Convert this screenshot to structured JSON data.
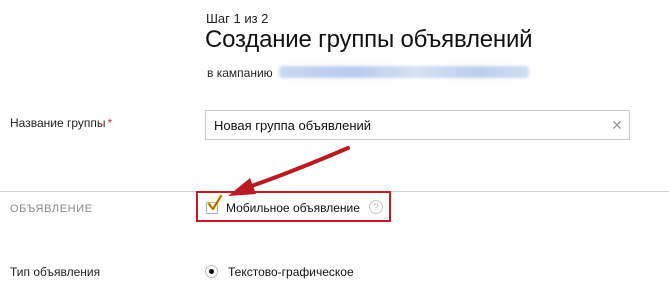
{
  "header": {
    "step": "Шаг 1 из 2",
    "title": "Создание группы объявлений",
    "campaign_label": "в кампанию"
  },
  "group_name": {
    "label": "Название группы",
    "required_mark": "*",
    "value": "Новая группа объявлений",
    "clear_icon": "close-icon"
  },
  "ad_section": {
    "label": "ОБЪЯВЛЕНИЕ",
    "mobile_checkbox": {
      "label": "Мобильное объявление",
      "checked": true,
      "help_icon": "question-icon"
    }
  },
  "ad_type": {
    "label": "Тип объявления",
    "selected_option": "Текстово-графическое"
  },
  "colors": {
    "highlight": "#c21d24",
    "arrow": "#b81c22",
    "required": "#d12a2a",
    "checkmark": "#e6a200"
  }
}
